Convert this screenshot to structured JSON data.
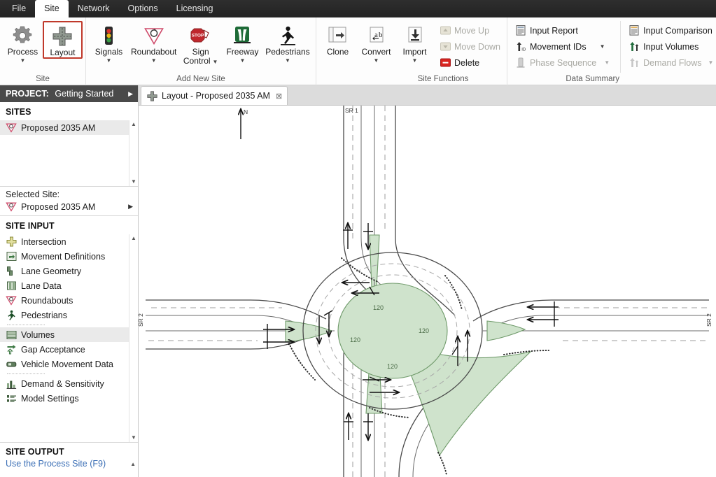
{
  "window": {
    "menu": [
      {
        "label": "File",
        "active": false
      },
      {
        "label": "Site",
        "active": true
      },
      {
        "label": "Network",
        "active": false
      },
      {
        "label": "Options",
        "active": false
      },
      {
        "label": "Licensing",
        "active": false
      }
    ]
  },
  "ribbon": {
    "groups": [
      {
        "title": "Site",
        "buttons": [
          {
            "label": "Process",
            "icon": "gear-icon",
            "caret": true,
            "selected": false
          },
          {
            "label": "Layout",
            "icon": "cross-intersection-icon",
            "caret": false,
            "selected": true
          }
        ]
      },
      {
        "title": "Add New Site",
        "buttons": [
          {
            "label": "Signals",
            "icon": "traffic-signal-icon",
            "caret": true,
            "selected": false
          },
          {
            "label": "Roundabout",
            "icon": "yield-triangle-icon",
            "caret": true,
            "selected": false
          },
          {
            "label": "Sign",
            "label2": "Control",
            "icon": "stop-sign-icon",
            "caret_inline": true,
            "selected": false
          },
          {
            "label": "Freeway",
            "icon": "freeway-icon",
            "caret": true,
            "selected": false
          },
          {
            "label": "Pedestrians",
            "icon": "pedestrian-icon",
            "caret": true,
            "selected": false
          }
        ]
      },
      {
        "title": "Site Functions",
        "buttons": [
          {
            "label": "Clone",
            "icon": "clone-icon",
            "caret": false,
            "selected": false
          },
          {
            "label": "Convert",
            "icon": "convert-ab-icon",
            "caret": true,
            "selected": false
          },
          {
            "label": "Import",
            "icon": "import-icon",
            "caret": true,
            "selected": false
          }
        ],
        "small": [
          {
            "label": "Move Up",
            "icon": "move-up-icon",
            "disabled": true,
            "caret": false
          },
          {
            "label": "Move Down",
            "icon": "move-down-icon",
            "disabled": true,
            "caret": false
          },
          {
            "label": "Delete",
            "icon": "delete-icon",
            "disabled": false,
            "caret": false
          }
        ]
      },
      {
        "title": "Data Summary",
        "col1": [
          {
            "label": "Input Report",
            "icon": "report-icon",
            "disabled": false,
            "caret": false
          },
          {
            "label": "Movement IDs",
            "icon": "movement-ids-icon",
            "disabled": false,
            "caret": true
          },
          {
            "label": "Phase Sequence",
            "icon": "phase-sequence-icon",
            "disabled": true,
            "caret": true
          }
        ],
        "col2": [
          {
            "label": "Input Comparison",
            "icon": "comparison-icon",
            "disabled": false,
            "caret": false
          },
          {
            "label": "Input Volumes",
            "icon": "input-volumes-icon",
            "disabled": false,
            "caret": false
          },
          {
            "label": "Demand Flows",
            "icon": "demand-flows-icon",
            "disabled": true,
            "caret": true
          }
        ]
      }
    ]
  },
  "sidebar": {
    "project_label": "PROJECT:",
    "project_name": "Getting Started",
    "sites_header": "SITES",
    "sites": [
      {
        "label": "Proposed 2035 AM",
        "icon": "yield-triangle-icon",
        "selected": true
      }
    ],
    "selected_site_label": "Selected Site:",
    "selected_site_name": "Proposed 2035 AM",
    "site_input_header": "SITE INPUT",
    "site_input": [
      {
        "label": "Intersection",
        "icon": "intersection-icon",
        "selected": false,
        "sep_after": false
      },
      {
        "label": "Movement Definitions",
        "icon": "movement-definitions-icon",
        "selected": false,
        "sep_after": false
      },
      {
        "label": "Lane Geometry",
        "icon": "lane-geometry-icon",
        "selected": false,
        "sep_after": false
      },
      {
        "label": "Lane Data",
        "icon": "lane-data-icon",
        "selected": false,
        "sep_after": false
      },
      {
        "label": "Roundabouts",
        "icon": "yield-triangle-icon",
        "selected": false,
        "sep_after": false
      },
      {
        "label": "Pedestrians",
        "icon": "pedestrian-icon",
        "selected": false,
        "sep_after": true
      },
      {
        "label": "Volumes",
        "icon": "volumes-icon",
        "selected": true,
        "sep_after": false
      },
      {
        "label": "Gap Acceptance",
        "icon": "gap-acceptance-icon",
        "selected": false,
        "sep_after": false
      },
      {
        "label": "Vehicle Movement Data",
        "icon": "vehicle-movement-icon",
        "selected": false,
        "sep_after": true
      },
      {
        "label": "Demand & Sensitivity",
        "icon": "demand-sensitivity-icon",
        "selected": false,
        "sep_after": false
      },
      {
        "label": "Model Settings",
        "icon": "model-settings-icon",
        "selected": false,
        "sep_after": false
      }
    ],
    "site_output_header": "SITE OUTPUT",
    "site_output_link": "Use the Process Site (F9)"
  },
  "tabs": [
    {
      "label": "Layout - Proposed 2035 AM",
      "icon": "cross-intersection-icon",
      "close": "⊠",
      "active": true
    }
  ],
  "canvas": {
    "north_label": "N",
    "road_labels": [
      {
        "text": "SR 1",
        "position": "north"
      },
      {
        "text": "SR 2",
        "position": "west"
      },
      {
        "text": "SR 2",
        "position": "east"
      }
    ],
    "island_volumes": [
      "120",
      "120",
      "120",
      "120"
    ],
    "colors": {
      "island_fill": "#cfe3cc",
      "island_stroke": "#6f9a6a",
      "road_stroke": "#4a4a4a",
      "lane_dash": "#9a9a9a"
    }
  }
}
